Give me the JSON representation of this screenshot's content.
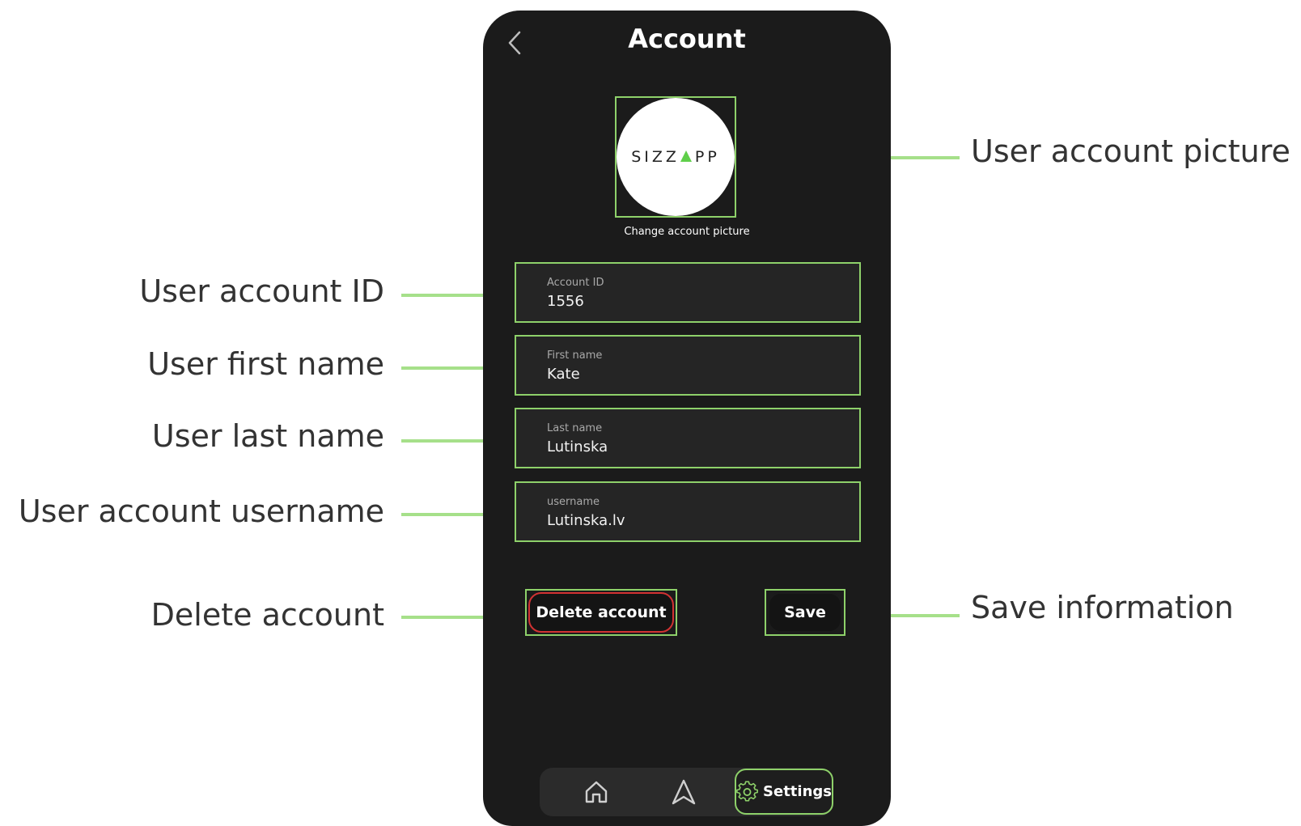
{
  "screen": {
    "title": "Account",
    "back_icon": "chevron-left-icon"
  },
  "avatar": {
    "logo_left": "SIZZ",
    "logo_right": "PP",
    "logo_mark_color": "#5fcf4a",
    "change_label": "Change account picture"
  },
  "fields": {
    "account_id": {
      "label": "Account ID",
      "value": "1556"
    },
    "first_name": {
      "label": "First name",
      "value": "Kate"
    },
    "last_name": {
      "label": "Last name",
      "value": "Lutinska"
    },
    "username": {
      "label": "username",
      "value": "Lutinska.lv"
    }
  },
  "actions": {
    "delete_label": "Delete account",
    "save_label": "Save"
  },
  "nav": {
    "items": [
      {
        "icon": "home-icon"
      },
      {
        "icon": "navigation-arrow-icon"
      },
      {
        "icon": "gear-icon",
        "label": "Settings"
      }
    ]
  },
  "annotations": {
    "account_picture": "User account picture",
    "account_id": "User account ID",
    "first_name": "User first name",
    "last_name": "User last name",
    "username": "User account username",
    "delete": "Delete account",
    "save": "Save information"
  },
  "colors": {
    "highlight": "#8ed16a",
    "connector": "#a6e08a",
    "phone_bg": "#1b1b1b",
    "delete_border": "#d23232"
  }
}
